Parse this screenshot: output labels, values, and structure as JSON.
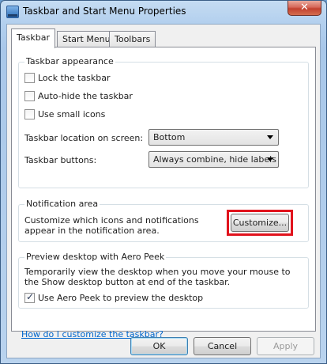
{
  "window": {
    "title": "Taskbar and Start Menu Properties",
    "close_label": "✕"
  },
  "tabs": [
    {
      "label": "Taskbar",
      "active": true
    },
    {
      "label": "Start Menu",
      "active": false
    },
    {
      "label": "Toolbars",
      "active": false
    }
  ],
  "appearance": {
    "title": "Taskbar appearance",
    "lock_label": "Lock the taskbar",
    "lock_checked": false,
    "autohide_label": "Auto-hide the taskbar",
    "autohide_checked": false,
    "small_icons_label": "Use small icons",
    "small_icons_checked": false,
    "location_label": "Taskbar location on screen:",
    "location_value": "Bottom",
    "buttons_label": "Taskbar buttons:",
    "buttons_value": "Always combine, hide labels"
  },
  "notification": {
    "title": "Notification area",
    "description": "Customize which icons and notifications appear in the notification area.",
    "customize_label": "Customize..."
  },
  "aero_peek": {
    "title": "Preview desktop with Aero Peek",
    "description": "Temporarily view the desktop when you move your mouse to the Show desktop button at end of the taskbar.",
    "checkbox_label": "Use Aero Peek to preview the desktop",
    "checked": true
  },
  "help_link": "How do I customize the taskbar?",
  "footer": {
    "ok_label": "OK",
    "cancel_label": "Cancel",
    "apply_label": "Apply"
  },
  "colors": {
    "highlight": "#e1131d",
    "link": "#0066cc"
  }
}
